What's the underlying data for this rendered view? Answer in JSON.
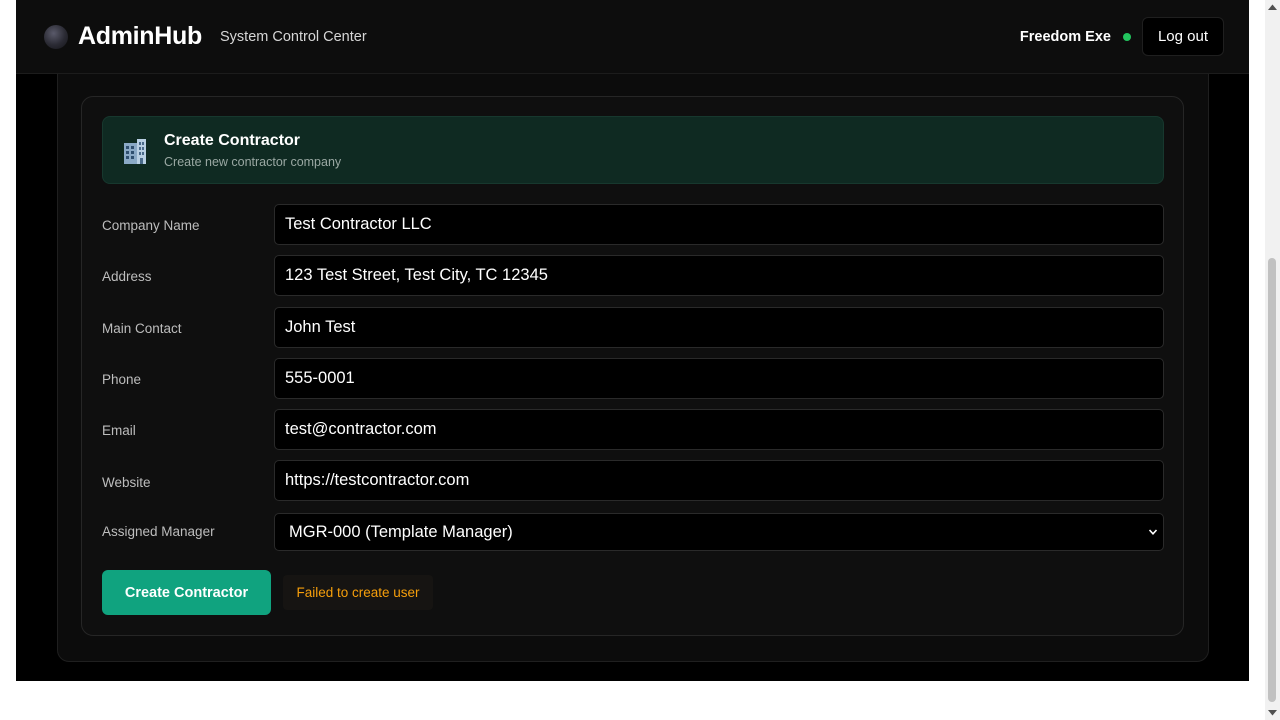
{
  "header": {
    "brand": "AdminHub",
    "subtitle": "System Control Center",
    "user_name": "Freedom Exe",
    "status_color": "#22c55e",
    "logout_label": "Log out"
  },
  "form": {
    "banner": {
      "icon": "building-icon",
      "title": "Create Contractor",
      "subtitle": "Create new contractor company"
    },
    "fields": [
      {
        "label": "Company Name",
        "value": "Test Contractor LLC"
      },
      {
        "label": "Address",
        "value": "123 Test Street, Test City, TC 12345"
      },
      {
        "label": "Main Contact",
        "value": "John Test"
      },
      {
        "label": "Phone",
        "value": "555-0001"
      },
      {
        "label": "Email",
        "value": "test@contractor.com"
      },
      {
        "label": "Website",
        "value": "https://testcontractor.com"
      }
    ],
    "manager": {
      "label": "Assigned Manager",
      "selected": "MGR-000 (Template Manager)"
    },
    "submit_label": "Create Contractor",
    "error_message": "Failed to create user",
    "accent_color": "#10a37f",
    "error_color": "#f59e0b"
  }
}
